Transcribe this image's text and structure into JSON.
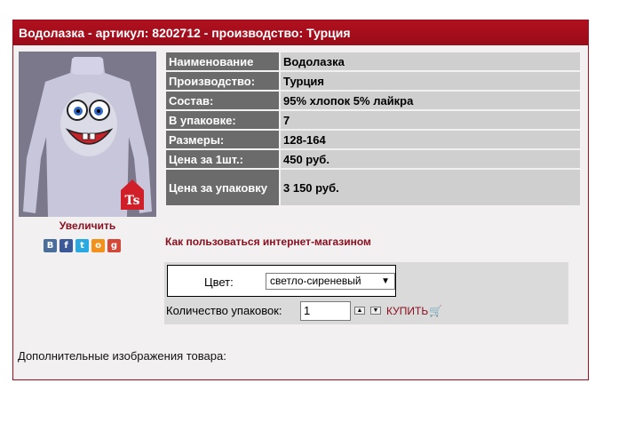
{
  "header": {
    "title": "Водолазка - артикул: 8202712 - производство: Турция"
  },
  "product": {
    "enlarge_label": "Увеличить",
    "share_icons": [
      "vk-icon",
      "facebook-icon",
      "twitter-icon",
      "odnoklassniki-icon",
      "google-plus-icon"
    ],
    "properties": [
      {
        "key": "Наименование",
        "value": "Водолазка"
      },
      {
        "key": "Производство:",
        "value": "Турция"
      },
      {
        "key": "Состав:",
        "value": "95% хлопок 5% лайкра"
      },
      {
        "key": "В упаковке:",
        "value": "7"
      },
      {
        "key": "Размеры:",
        "value": "128-164"
      },
      {
        "key": "Цена за 1шт.:",
        "value": "450 руб."
      },
      {
        "key": "Цена за упаковку",
        "value": "3 150 руб."
      }
    ],
    "howto_link": "Как пользоваться интернет-магазином"
  },
  "order": {
    "color_label": "Цвет:",
    "color_selected": "светло-сиреневый",
    "qty_label": "Количество упаковок:",
    "qty_value": "1",
    "buy_label": "КУПИТЬ"
  },
  "extra_images_label": "Дополнительные изображения товара:",
  "colors": {
    "brand_red": "#9b0f1e",
    "key_bg": "#6b6b6b",
    "value_bg": "#cfcfcf"
  }
}
